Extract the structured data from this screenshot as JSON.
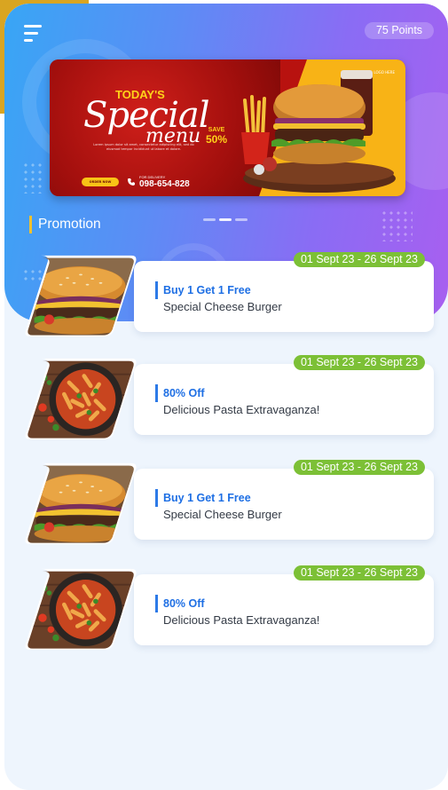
{
  "header": {
    "points": "75 Points",
    "menu_icon": "hamburger-menu-icon"
  },
  "banner": {
    "today": "TODAY'S",
    "special": "Special",
    "menu": "menu",
    "lorem": "Lorem ipsum dolor sit amet, consectetur adipiscing elit, sed do eiusmod tempor incididunt ut labore et dolore.",
    "save_label": "SAVE",
    "save_value": "50%",
    "order_button": "ORDER NOW",
    "delivery_label": "FOR DELIVERY",
    "phone": "098-654-828",
    "logo_text": "LOGO HERE"
  },
  "carousel": {
    "count": 3,
    "active": 1
  },
  "section": {
    "title": "Promotion"
  },
  "promotions": [
    {
      "date": "01 Sept 23 - 26 Sept 23",
      "offer": "Buy 1 Get 1 Free",
      "item": "Special Cheese Burger",
      "image": "burger"
    },
    {
      "date": "01 Sept 23 - 26 Sept 23",
      "offer": "80% Off",
      "item": "Delicious Pasta Extravaganza!",
      "image": "pasta"
    },
    {
      "date": "01 Sept 23 - 26 Sept 23",
      "offer": "Buy 1 Get 1 Free",
      "item": "Special Cheese Burger",
      "image": "burger"
    },
    {
      "date": "01 Sept 23 - 26 Sept 23",
      "offer": "80% Off",
      "item": "Delicious Pasta Extravaganza!",
      "image": "pasta"
    }
  ],
  "colors": {
    "header_gradient_start": "#38a6f5",
    "header_gradient_end": "#a85ff0",
    "date_badge": "#7cc036",
    "offer_text": "#1e6fe4",
    "section_accent": "#f2c12e",
    "banner_red": "#b8120f",
    "banner_yellow": "#f8b316"
  }
}
